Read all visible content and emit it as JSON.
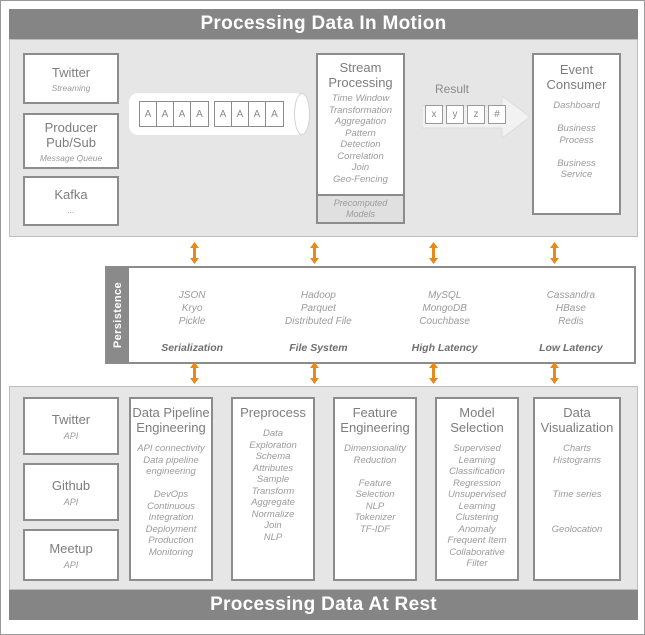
{
  "banners": {
    "top": "Processing Data In Motion",
    "bottom": "Processing Data At Rest"
  },
  "colors": {
    "banner_bg": "#858585",
    "panel_bg": "#e6e6e6",
    "box_border": "#8c8c8c",
    "text_gray": "#8a8a8a",
    "arrow_orange": "#E8891C",
    "persistence_label_bg": "#8a8a8a"
  },
  "motion": {
    "sources": [
      {
        "title": "Twitter",
        "sub": "Streaming"
      },
      {
        "title": "Producer\nPub/Sub",
        "sub": "Message Queue"
      },
      {
        "title": "Kafka",
        "sub": "..."
      }
    ],
    "pipe": {
      "group1": [
        "A",
        "A",
        "A",
        "A"
      ],
      "group2": [
        "A",
        "A",
        "A",
        "A"
      ]
    },
    "stream_processing": {
      "title": "Stream\nProcessing",
      "items": "Time Window\nTransformation\nAggregation\nPattern\nDetection\nCorrelation\nJoin\nGeo-Fencing",
      "precomputed": "Precomputed\nModels"
    },
    "result": {
      "label": "Result",
      "cells": [
        "x",
        "y",
        "z",
        "#"
      ]
    },
    "event_consumer": {
      "title": "Event\nConsumer",
      "items": "Dashboard\n\nBusiness\nProcess\n\nBusiness\nService"
    }
  },
  "persistence": {
    "label": "Persistence",
    "columns": [
      {
        "items": "JSON\nKryo\nPickle",
        "label": "Serialization"
      },
      {
        "items": "Hadoop\nParquet\nDistributed File",
        "label": "File System"
      },
      {
        "items": "MySQL\nMongoDB\nCouchbase",
        "label": "High Latency"
      },
      {
        "items": "Cassandra\nHBase\nRedis",
        "label": "Low Latency"
      }
    ]
  },
  "rest": {
    "sources": [
      {
        "title": "Twitter",
        "sub": "API"
      },
      {
        "title": "Github",
        "sub": "API"
      },
      {
        "title": "Meetup",
        "sub": "API"
      }
    ],
    "stages": [
      {
        "title": "Data Pipeline\nEngineering",
        "items": "API connectivity\nData pipeline\nengineering\n\nDevOps\nContinuous\nIntegration\nDeployment\nProduction\nMonitoring"
      },
      {
        "title": "Preprocess",
        "items": "Data\nExploration\nSchema\nAttributes\nSample\nTransform\nAggregate\nNormalize\nJoin\nNLP"
      },
      {
        "title": "Feature\nEngineering",
        "items": "Dimensionality\nReduction\n\nFeature\nSelection\nNLP\nTokenizer\nTF-IDF"
      },
      {
        "title": "Model\nSelection",
        "items": "Supervised\nLearning\nClassification\nRegression\nUnsupervised\nLearning\nClustering\nAnomaly\nFrequent Item\nCollaborative\nFilter"
      },
      {
        "title": "Data\nVisualization",
        "items": "Charts\nHistograms\n\n\nTime series\n\n\nGeolocation"
      }
    ]
  }
}
